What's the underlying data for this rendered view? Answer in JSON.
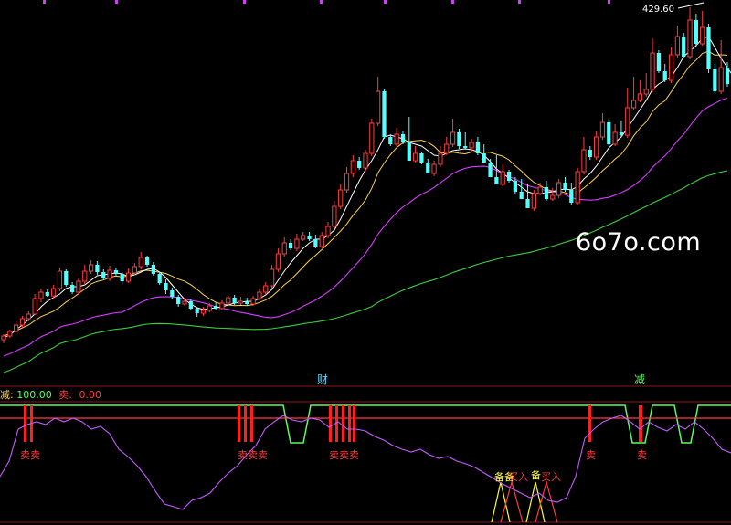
{
  "watermark": "6o7o.com",
  "price_annotation": "429.60",
  "indicator": {
    "label1": "减:",
    "value1": "100.00",
    "label2": "卖:",
    "value2": "0.00"
  },
  "top_markers": [
    {
      "text": "财"
    },
    {
      "text": "减"
    }
  ],
  "sell_labels": [
    {
      "text": "卖卖"
    },
    {
      "text": "卖卖卖"
    },
    {
      "text": "卖卖卖"
    },
    {
      "text": "卖"
    },
    {
      "text": "卖"
    }
  ],
  "buy_labels": [
    {
      "text": "备备"
    },
    {
      "text": "买入"
    },
    {
      "text": "备"
    },
    {
      "text": "买入"
    }
  ],
  "colors": {
    "up": "#ff3c3c",
    "down": "#54ffff",
    "ma_short": "#ffffff",
    "ma_mid": "#ffd24a",
    "ma_long": "#d63cff",
    "ma_xlong": "#3ccc3c",
    "indicator_line": "#c45cff",
    "band": "#59ff59"
  },
  "chart_data": {
    "type": "candlestick",
    "title": "",
    "price_high_label": 429.6,
    "candles": [
      [
        372,
        368,
        376,
        366
      ],
      [
        368,
        363,
        370,
        361
      ],
      [
        363,
        356,
        366,
        352
      ],
      [
        356,
        349,
        359,
        346
      ],
      [
        349,
        344,
        352,
        341
      ],
      [
        344,
        327,
        345,
        322
      ],
      [
        327,
        320,
        331,
        316
      ],
      [
        320,
        324,
        325,
        317
      ],
      [
        324,
        316,
        327,
        312
      ],
      [
        316,
        297,
        319,
        293
      ],
      [
        297,
        312,
        314,
        295
      ],
      [
        312,
        320,
        322,
        309
      ],
      [
        320,
        308,
        323,
        305
      ],
      [
        308,
        297,
        311,
        290
      ],
      [
        297,
        290,
        300,
        285
      ],
      [
        290,
        298,
        301,
        286
      ],
      [
        298,
        305,
        306,
        295
      ],
      [
        305,
        296,
        308,
        291
      ],
      [
        296,
        300,
        302,
        293
      ],
      [
        300,
        308,
        311,
        298
      ],
      [
        308,
        299,
        310,
        294
      ],
      [
        299,
        292,
        301,
        288
      ],
      [
        292,
        282,
        295,
        276
      ],
      [
        282,
        290,
        292,
        280
      ],
      [
        290,
        300,
        302,
        287
      ],
      [
        300,
        310,
        312,
        298
      ],
      [
        310,
        318,
        322,
        306
      ],
      [
        318,
        325,
        328,
        315
      ],
      [
        325,
        333,
        336,
        323
      ],
      [
        333,
        330,
        335,
        326
      ],
      [
        330,
        338,
        340,
        327
      ],
      [
        338,
        343,
        347,
        336
      ],
      [
        343,
        340,
        346,
        336
      ],
      [
        340,
        335,
        342,
        332
      ],
      [
        335,
        338,
        340,
        331
      ],
      [
        338,
        332,
        340,
        329
      ],
      [
        332,
        326,
        334,
        324
      ],
      [
        326,
        332,
        334,
        323
      ],
      [
        332,
        330,
        334,
        325
      ],
      [
        330,
        333,
        335,
        326
      ],
      [
        333,
        327,
        335,
        324
      ],
      [
        327,
        320,
        329,
        316
      ],
      [
        320,
        313,
        322,
        309
      ],
      [
        313,
        295,
        317,
        290
      ],
      [
        295,
        278,
        298,
        272
      ],
      [
        278,
        266,
        281,
        260
      ],
      [
        266,
        272,
        274,
        262
      ],
      [
        272,
        262,
        275,
        256
      ],
      [
        262,
        258,
        264,
        254
      ],
      [
        258,
        262,
        264,
        254
      ],
      [
        262,
        270,
        272,
        257
      ],
      [
        270,
        258,
        272,
        254
      ],
      [
        258,
        248,
        261,
        243
      ],
      [
        248,
        226,
        250,
        220
      ],
      [
        226,
        208,
        229,
        202
      ],
      [
        208,
        190,
        211,
        183
      ],
      [
        190,
        176,
        194,
        170
      ],
      [
        176,
        184,
        186,
        172
      ],
      [
        184,
        168,
        188,
        164
      ],
      [
        168,
        135,
        171,
        130
      ],
      [
        135,
        100,
        138,
        84
      ],
      [
        100,
        150,
        152,
        97
      ],
      [
        150,
        158,
        160,
        147
      ],
      [
        158,
        147,
        160,
        140
      ],
      [
        147,
        156,
        158,
        144
      ],
      [
        156,
        176,
        158,
        128
      ],
      [
        176,
        168,
        178,
        160
      ],
      [
        168,
        178,
        180,
        166
      ],
      [
        178,
        190,
        182,
        174
      ],
      [
        190,
        180,
        193,
        176
      ],
      [
        180,
        168,
        183,
        160
      ],
      [
        168,
        158,
        170,
        150
      ],
      [
        158,
        145,
        161,
        130
      ],
      [
        145,
        160,
        163,
        141
      ],
      [
        160,
        162,
        164,
        145
      ],
      [
        162,
        156,
        166,
        152
      ],
      [
        156,
        168,
        170,
        150
      ],
      [
        168,
        178,
        170,
        158
      ],
      [
        178,
        194,
        180,
        174
      ],
      [
        194,
        202,
        200,
        170
      ],
      [
        202,
        188,
        204,
        180
      ],
      [
        188,
        198,
        200,
        186
      ],
      [
        198,
        210,
        212,
        194
      ],
      [
        210,
        218,
        212,
        196
      ],
      [
        218,
        228,
        222,
        202
      ],
      [
        228,
        212,
        231,
        208
      ],
      [
        212,
        205,
        214,
        200
      ],
      [
        205,
        218,
        220,
        198
      ],
      [
        218,
        214,
        220,
        206
      ],
      [
        214,
        200,
        217,
        196
      ],
      [
        200,
        208,
        210,
        194
      ],
      [
        208,
        222,
        224,
        200
      ],
      [
        222,
        188,
        224,
        184
      ],
      [
        188,
        164,
        191,
        150
      ],
      [
        164,
        172,
        175,
        160
      ],
      [
        172,
        150,
        175,
        144
      ],
      [
        150,
        134,
        153,
        124
      ],
      [
        134,
        158,
        160,
        130
      ],
      [
        158,
        145,
        160,
        136
      ],
      [
        145,
        148,
        150,
        132
      ],
      [
        148,
        118,
        151,
        96
      ],
      [
        118,
        110,
        121,
        84
      ],
      [
        110,
        103,
        112,
        88
      ],
      [
        103,
        98,
        106,
        80
      ],
      [
        98,
        58,
        101,
        42
      ],
      [
        58,
        78,
        80,
        55
      ],
      [
        78,
        88,
        90,
        70
      ],
      [
        88,
        60,
        91,
        52
      ],
      [
        60,
        40,
        63,
        28
      ],
      [
        40,
        62,
        64,
        36
      ],
      [
        62,
        22,
        65,
        8
      ],
      [
        22,
        48,
        50,
        15
      ],
      [
        48,
        30,
        50,
        12
      ],
      [
        30,
        76,
        80,
        26
      ],
      [
        76,
        100,
        102,
        70
      ],
      [
        100,
        74,
        103,
        44
      ],
      [
        74,
        92,
        95,
        68
      ]
    ],
    "ma_short": [
      370,
      367,
      361,
      356,
      350,
      344,
      336,
      330,
      326,
      322,
      316,
      314,
      314,
      312,
      307,
      302,
      301,
      300,
      299,
      300,
      303,
      301,
      298,
      295,
      294,
      298,
      304,
      312,
      320,
      328,
      333,
      337,
      339,
      338,
      337,
      336,
      334,
      332,
      331,
      330,
      330,
      327,
      323,
      317,
      307,
      297,
      288,
      280,
      272,
      266,
      262,
      262,
      258,
      252,
      240,
      226,
      212,
      198,
      186,
      176,
      164,
      150,
      148,
      150,
      152,
      156,
      158,
      160,
      165,
      170,
      171,
      168,
      165,
      164,
      163,
      164,
      166,
      170,
      177,
      185,
      190,
      195,
      200,
      205,
      210,
      212,
      212,
      211,
      210,
      208,
      207,
      208,
      204,
      196,
      190,
      182,
      172,
      162,
      156,
      150,
      140,
      130,
      120,
      110,
      98,
      92,
      88,
      84,
      74,
      62,
      56,
      50,
      42,
      40,
      52,
      64,
      74,
      84
    ]
  }
}
